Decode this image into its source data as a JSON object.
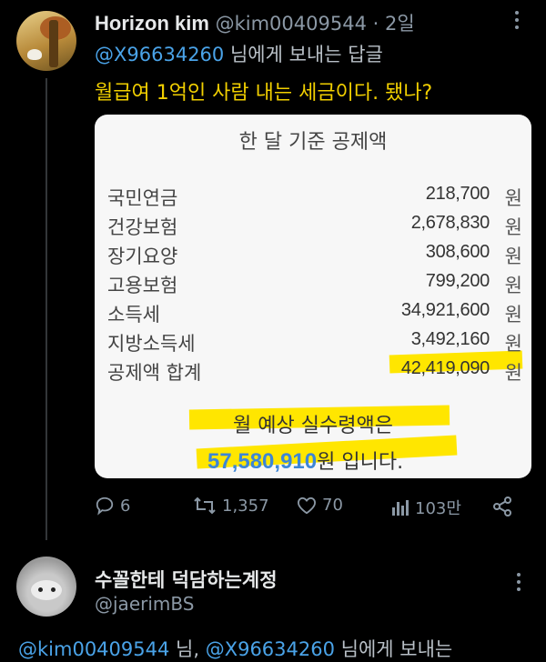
{
  "tweet": {
    "author_name": "Horizon kim",
    "handle": "@kim00409544",
    "separator": "·",
    "time": "2일",
    "reply_to_mention": "@X96634260",
    "reply_to_suffix": " 님에게 보내는 답글",
    "text": "월급여 1억인 사람 내는 세금이다. 됐나?",
    "image": {
      "title": "한 달 기준 공제액",
      "rows": [
        {
          "label": "국민연금",
          "value": "218,700",
          "unit": "원"
        },
        {
          "label": "건강보험",
          "value": "2,678,830",
          "unit": "원"
        },
        {
          "label": "장기요양",
          "value": "308,600",
          "unit": "원"
        },
        {
          "label": "고용보험",
          "value": "799,200",
          "unit": "원"
        },
        {
          "label": "소득세",
          "value": "34,921,600",
          "unit": "원"
        },
        {
          "label": "지방소득세",
          "value": "3,492,160",
          "unit": "원"
        },
        {
          "label": "공제액 합계",
          "value": "42,419,090",
          "unit": "원"
        }
      ],
      "summary_line1": "월 예상 실수령액은",
      "summary_amount": "57,580,910",
      "summary_tail": "원 입니다."
    },
    "actions": {
      "replies": "6",
      "retweets": "1,357",
      "likes": "70",
      "views": "103만"
    }
  },
  "reply_tweet": {
    "author_name": "수꼴한테 덕담하는계정",
    "handle": "@jaerimBS",
    "reply_mention1": "@kim00409544",
    "reply_mid": " 님, ",
    "reply_mention2": "@X96634260",
    "reply_suffix": " 님에게 보내는"
  },
  "colors": {
    "background": "#000000",
    "mention": "#4aa3e8",
    "tweet_text": "#f2d000",
    "highlight": "#ffe600",
    "amount": "#3d86d6",
    "muted": "#8b98a5"
  },
  "icons": [
    "reply-icon",
    "retweet-icon",
    "heart-icon",
    "views-icon",
    "share-icon",
    "more-icon"
  ]
}
